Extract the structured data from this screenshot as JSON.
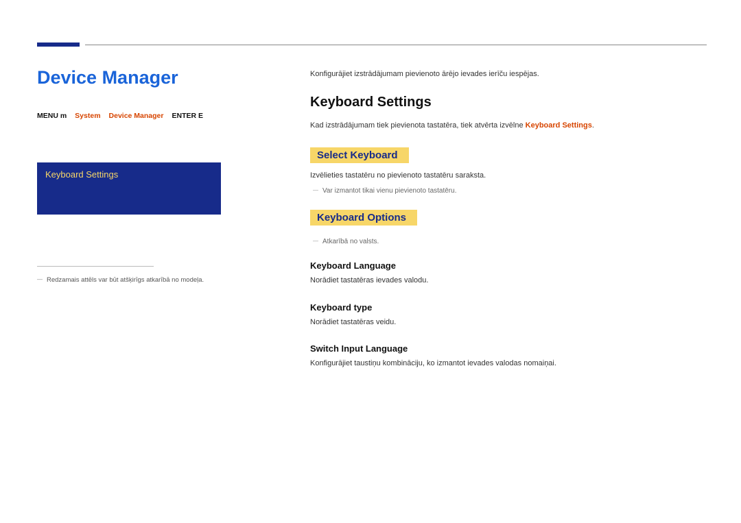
{
  "page": {
    "title": "Device Manager"
  },
  "breadcrumb": {
    "menu": "MENU m",
    "system": "System",
    "device_manager": "Device Manager",
    "enter": "ENTER E"
  },
  "panel": {
    "item": "Keyboard Settings"
  },
  "footnote": "Redzamais attēls var būt atšķirīgs atkarībā no modeļa.",
  "right": {
    "intro": "Konfigurājiet izstrādājumam pievienoto ārējo ievades ierīču iespējas.",
    "h_settings": "Keyboard Settings",
    "settings_text_before": "Kad izstrādājumam tiek pievienota tastatēra, tiek atvērta izvēlne ",
    "settings_highlight": "Keyboard Settings",
    "settings_text_after": ".",
    "select_label": "Select Keyboard",
    "select_desc": "Izvēlieties tastatēru no pievienoto tastatēru saraksta.",
    "select_bullet": "Var izmantot tikai vienu pievienoto tastatēru.",
    "options_label": "Keyboard Options",
    "options_bullet": "Atkarībā no valsts.",
    "lang_h": "Keyboard Language",
    "lang_desc": "Norādiet tastatēras ievades valodu.",
    "type_h": "Keyboard type",
    "type_desc": "Norādiet tastatēras veidu.",
    "switch_h": "Switch Input Language",
    "switch_desc": "Konfigurājiet taustiņu kombināciju, ko izmantot ievades valodas nomaiņai."
  }
}
